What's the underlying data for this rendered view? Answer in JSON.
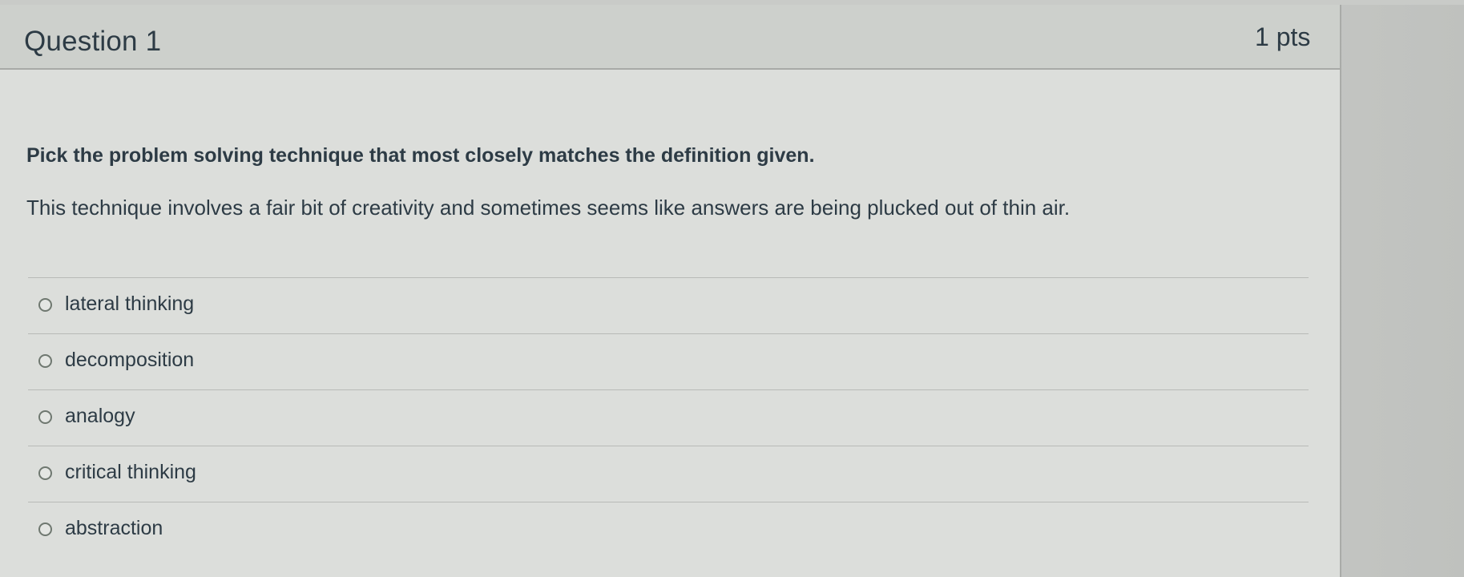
{
  "question": {
    "title": "Question 1",
    "points": "1 pts",
    "prompt": "Pick the problem solving technique that most closely matches the definition given.",
    "definition": "This technique involves a fair bit of creativity and sometimes seems like answers are being plucked out of thin air.",
    "answers": [
      {
        "label": "lateral thinking"
      },
      {
        "label": "decomposition"
      },
      {
        "label": "analogy"
      },
      {
        "label": "critical thinking"
      },
      {
        "label": "abstraction"
      }
    ]
  }
}
